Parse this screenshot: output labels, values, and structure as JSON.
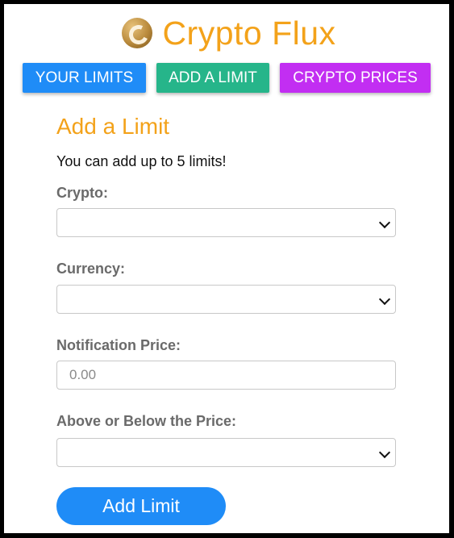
{
  "app": {
    "title": "Crypto Flux",
    "logo_icon": "crypto-coin-icon"
  },
  "nav": {
    "your_limits": "YOUR LIMITS",
    "add_a_limit": "ADD A LIMIT",
    "crypto_prices": "CRYPTO PRICES",
    "colors": {
      "your_limits": "#1f8cf7",
      "add_a_limit": "#26b58a",
      "crypto_prices": "#c22ef2"
    }
  },
  "form": {
    "title": "Add a Limit",
    "info": "You can add up to 5 limits!",
    "crypto_label": "Crypto:",
    "crypto_value": "",
    "currency_label": "Currency:",
    "currency_value": "",
    "price_label": "Notification Price:",
    "price_value": "",
    "price_placeholder": "0.00",
    "direction_label": "Above or Below the Price:",
    "direction_value": "",
    "submit_label": "Add Limit"
  },
  "colors": {
    "accent": "#f3a21a",
    "primary": "#1f8cf7"
  }
}
